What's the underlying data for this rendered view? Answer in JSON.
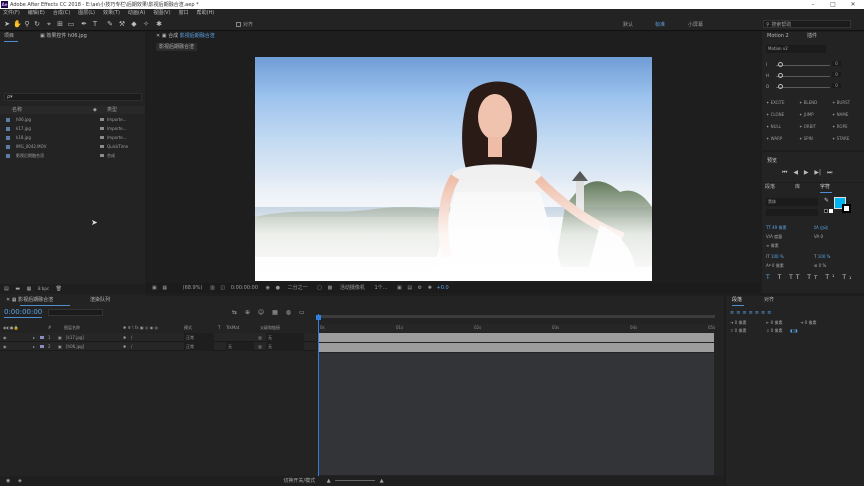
{
  "window": {
    "title": "Adobe After Effects CC 2018 - E:\\ae\\小技巧专栏\\后期效果\\影视后期融合渲.aep *",
    "app_icon": "Ae"
  },
  "menu": [
    "文件(F)",
    "编辑(E)",
    "合成(C)",
    "图层(L)",
    "效果(T)",
    "动画(A)",
    "视图(V)",
    "窗口",
    "帮助(H)"
  ],
  "toolbar": {
    "snap_label": "对齐",
    "workspaces": [
      "默认",
      "标准",
      "小屏幕"
    ],
    "search_placeholder": "搜索帮助"
  },
  "project": {
    "tabs": [
      "项目",
      "效果控件 h06.jpg"
    ],
    "search_placeholder": "ρ▾",
    "columns": [
      "名称",
      "类型"
    ],
    "items": [
      {
        "name": "h06.jpg",
        "type": "Importe..."
      },
      {
        "name": "k17.jpg",
        "type": "Importe..."
      },
      {
        "name": "k18.jpg",
        "type": "Importe..."
      },
      {
        "name": "IMG_0042.MOV",
        "type": "QuickTime"
      },
      {
        "name": "影视后期融合渲",
        "type": "合成"
      }
    ],
    "bpc": "8 bpc"
  },
  "composition": {
    "panel_label": "合成",
    "tab": "影视后期融合渲",
    "flow_tab": "影视后期融合渲",
    "zoom": "(68.9%)",
    "timecode": "0:00:00:00",
    "resolution": "二分之一",
    "camera": "活动摄像机",
    "views": "1个...",
    "exposure": "+0.0"
  },
  "timeline": {
    "tabs": [
      "影视后期融合渲",
      "渲染队列"
    ],
    "current_time": "0:00:00:00",
    "columns": [
      "图层名称",
      "模式",
      "T",
      "TrkMat",
      "父级和链接"
    ],
    "layers": [
      {
        "num": "1",
        "name": "[k17.jpg]",
        "mode": "正常",
        "trkmat": "",
        "parent": "无"
      },
      {
        "num": "2",
        "name": "[h06.jpg]",
        "mode": "正常",
        "trkmat": "无",
        "parent": "无"
      }
    ],
    "ruler": [
      "0s",
      "01s",
      "02s",
      "03s",
      "04s",
      "05s"
    ],
    "footer": "切换开关/模式"
  },
  "right_panel": {
    "tabs": [
      "Motion 2",
      "插件"
    ],
    "preset": "Motion v2",
    "rows": [
      "0",
      "0",
      "0"
    ],
    "buttons": [
      "EXCITE",
      "BLEND",
      "BURST",
      "CLONE",
      "JUMP",
      "NAME",
      "NULL",
      "ORBIT",
      "ROPE",
      "WARP",
      "SPIN",
      "STARE"
    ],
    "preview_title": "预览",
    "char_tabs": [
      "段落",
      "库",
      "字符"
    ],
    "font_name": "黑体",
    "font_size": "49 像素",
    "leading": "自动",
    "kerning": "度量",
    "tracking": "0",
    "stroke_width": "像素",
    "vscale": "100 %",
    "hscale": "100 %",
    "baseline": "0 像素",
    "tsume": "0 %",
    "text_color": "#00b3f0",
    "align_tabs": [
      "段落",
      "对齐"
    ],
    "indent_values": [
      "0 像素",
      "0 像素",
      "0 像素",
      "0 像素",
      "0 像素"
    ]
  }
}
